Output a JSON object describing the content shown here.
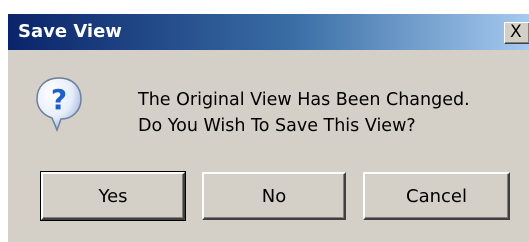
{
  "window": {
    "title": "Save View",
    "close_glyph": "X"
  },
  "icon": {
    "name": "question-icon",
    "glyph": "?"
  },
  "message": {
    "line1": "The Original View Has Been Changed.",
    "line2": "Do You Wish To Save This View?"
  },
  "buttons": {
    "yes": "Yes",
    "no": "No",
    "cancel": "Cancel"
  },
  "colors": {
    "titlebar_start": "#0a246a",
    "titlebar_end": "#a6caf0",
    "dialog_face": "#d4d0c8",
    "icon_blue": "#1f5fc8"
  }
}
